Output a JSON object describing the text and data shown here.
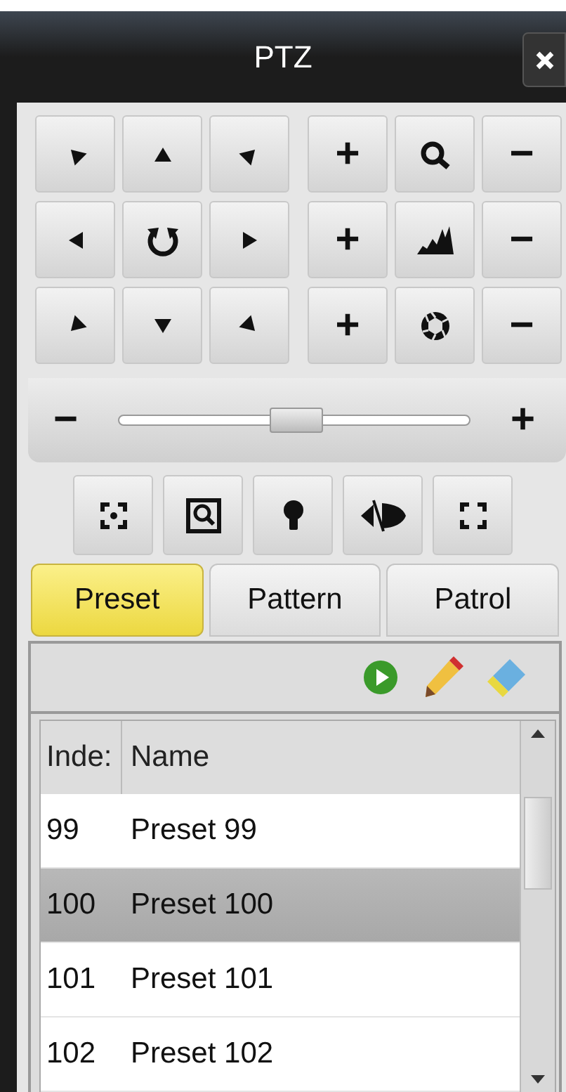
{
  "window": {
    "title": "PTZ"
  },
  "lens_rows": [
    {
      "kind": "zoom",
      "plus": "+",
      "minus": "−"
    },
    {
      "kind": "focus",
      "plus": "+",
      "minus": "−"
    },
    {
      "kind": "iris",
      "plus": "+",
      "minus": "−"
    }
  ],
  "speed_slider": {
    "minus": "−",
    "plus": "+",
    "level": 0.5
  },
  "tabs": [
    {
      "label": "Preset",
      "selected": true
    },
    {
      "label": "Pattern",
      "selected": false
    },
    {
      "label": "Patrol",
      "selected": false
    }
  ],
  "table": {
    "columns": [
      "Inde:",
      "Name"
    ],
    "rows": [
      {
        "index": "99",
        "name": "Preset 99",
        "selected": false
      },
      {
        "index": "100",
        "name": "Preset 100",
        "selected": true
      },
      {
        "index": "101",
        "name": "Preset 101",
        "selected": false
      },
      {
        "index": "102",
        "name": "Preset 102",
        "selected": false
      }
    ]
  }
}
